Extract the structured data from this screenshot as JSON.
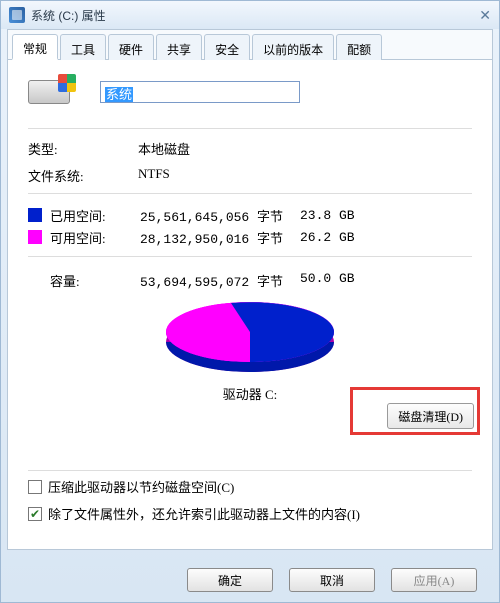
{
  "window": {
    "title": "系统 (C:) 属性",
    "close_glyph": "✕"
  },
  "tabs": [
    {
      "label": "常规",
      "active": true
    },
    {
      "label": "工具"
    },
    {
      "label": "硬件"
    },
    {
      "label": "共享"
    },
    {
      "label": "安全"
    },
    {
      "label": "以前的版本"
    },
    {
      "label": "配额"
    }
  ],
  "drive": {
    "name_selected": "系统",
    "type_label": "类型:",
    "type_value": "本地磁盘",
    "fs_label": "文件系统:",
    "fs_value": "NTFS",
    "caption": "驱动器 C:"
  },
  "space": {
    "used_label": "已用空间:",
    "used_bytes": "25,561,645,056 字节",
    "used_gb": "23.8 GB",
    "free_label": "可用空间:",
    "free_bytes": "28,132,950,016 字节",
    "free_gb": "26.2 GB",
    "cap_label": "容量:",
    "cap_bytes": "53,694,595,072 字节",
    "cap_gb": "50.0 GB"
  },
  "chart_data": {
    "type": "pie",
    "title": "",
    "series": [
      {
        "name": "已用空间",
        "value": 25561645056,
        "value_gb": 23.8,
        "color": "#0020cc"
      },
      {
        "name": "可用空间",
        "value": 28132950016,
        "value_gb": 26.2,
        "color": "#ff00ff"
      }
    ],
    "total": 53694595072,
    "total_gb": 50.0
  },
  "cleanup": {
    "label": "磁盘清理(D)"
  },
  "checks": {
    "compress": {
      "checked": false,
      "label": "压缩此驱动器以节约磁盘空间(C)"
    },
    "index": {
      "checked": true,
      "label": "除了文件属性外，还允许索引此驱动器上文件的内容(I)"
    }
  },
  "buttons": {
    "ok": "确定",
    "cancel": "取消",
    "apply": "应用(A)"
  }
}
